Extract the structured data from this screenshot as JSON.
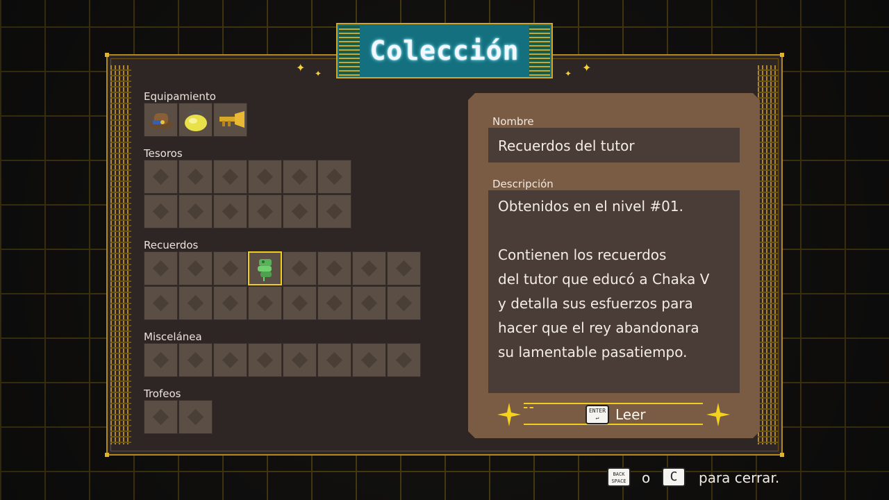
{
  "title": "Colección",
  "sections": [
    {
      "key": "equipment",
      "label": "Equipamiento"
    },
    {
      "key": "treasures",
      "label": "Tesoros"
    },
    {
      "key": "memories",
      "label": "Recuerdos"
    },
    {
      "key": "misc",
      "label": "Miscelánea"
    },
    {
      "key": "trophies",
      "label": "Trofeos"
    }
  ],
  "detail": {
    "name_label": "Nombre",
    "name_value": "Recuerdos del tutor",
    "description_label": "Descripción",
    "description_lines": [
      "Obtenidos en el nivel #01.",
      "",
      "Contienen los recuerdos",
      "del tutor que educó a Chaka V",
      "y detalla sus esfuerzos para",
      "hacer que el rey abandonara",
      "su lamentable pasatiempo."
    ],
    "read_key": "ENTER",
    "read_label": "Leer"
  },
  "footer": {
    "back_key": "BACK SPACE",
    "or_text": "o",
    "close_key": "C",
    "close_text": "para cerrar."
  },
  "colors": {
    "accent": "#f0cd1e",
    "frame": "#b38a1d",
    "title_bg": "#14707e"
  }
}
